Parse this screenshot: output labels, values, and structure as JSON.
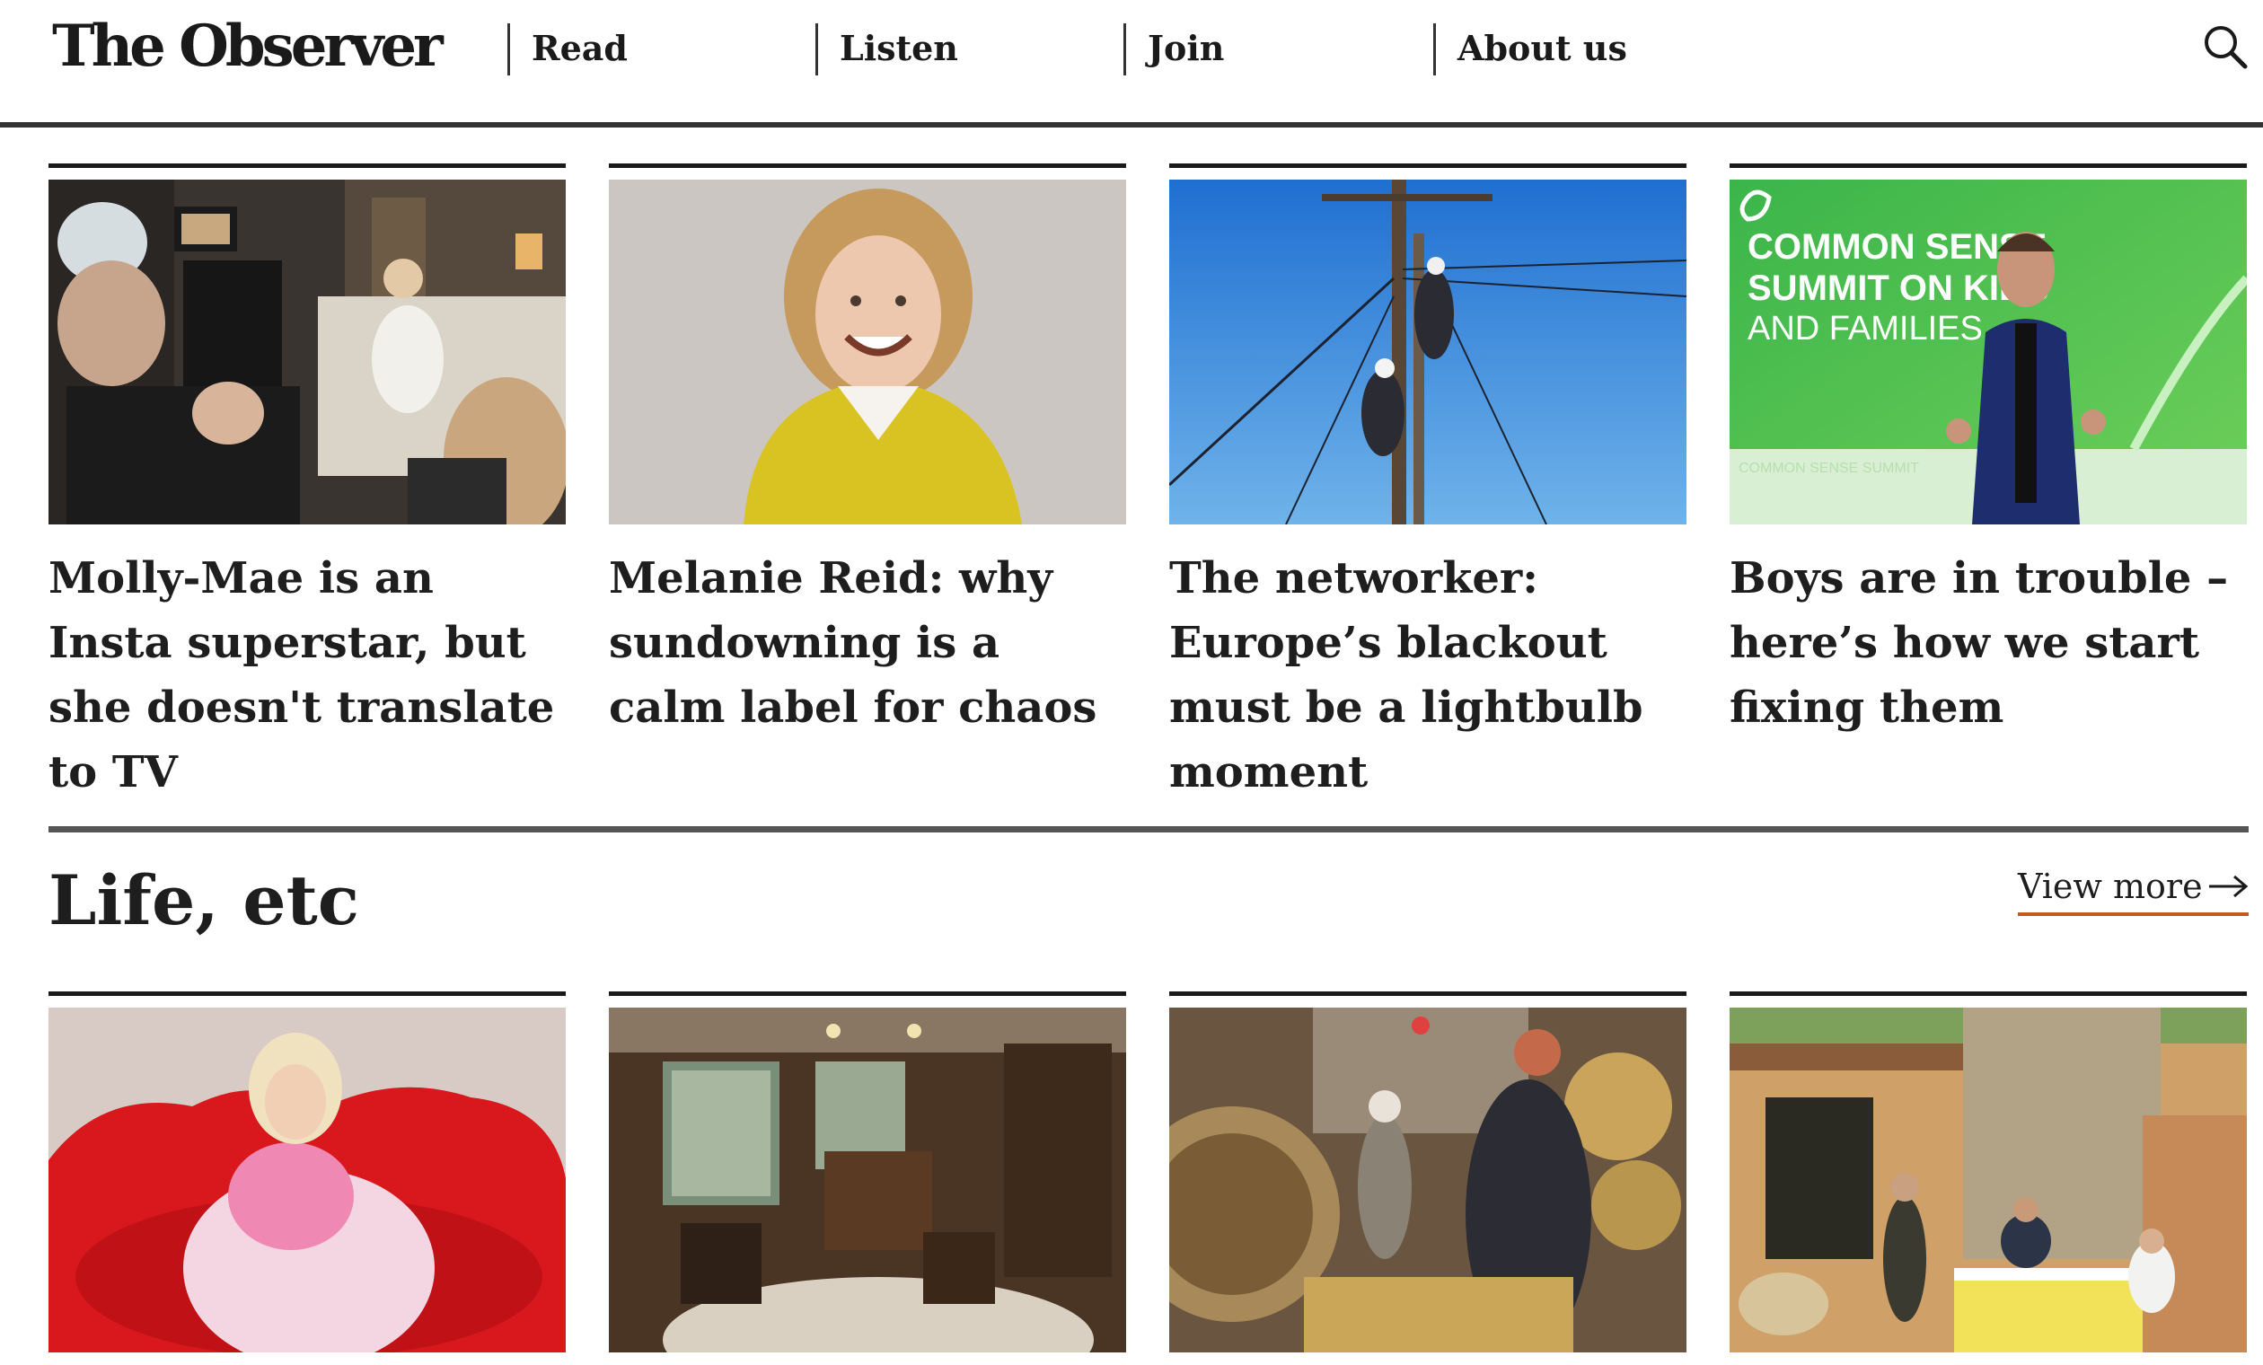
{
  "header": {
    "logo": "The Observer",
    "nav": [
      {
        "label": "Read"
      },
      {
        "label": "Listen"
      },
      {
        "label": "Join"
      },
      {
        "label": "About us"
      }
    ],
    "search_icon": "search-icon"
  },
  "top_cards": [
    {
      "headline": "Molly-Mae is an Insta superstar, but she doesn't translate to TV"
    },
    {
      "headline": "Melanie Reid: why sundowning is a calm label for chaos"
    },
    {
      "headline": "The networker: Europe’s blackout must be a lightbulb moment"
    },
    {
      "headline": "Boys are in trouble – here’s how we start fixing them"
    }
  ],
  "image_4": {
    "banner_line1": "COMMON SENSE",
    "banner_line2": "SUMMIT ON KIDS",
    "banner_line3": "AND FAMILIES",
    "strip_text": "COMMON SENSE SUMMIT"
  },
  "section": {
    "title": "Life, etc",
    "view_more": "View more",
    "arrow_icon": "arrow-right-icon"
  },
  "colors": {
    "accent_underline": "#c65a1a",
    "rule": "#1a1a1a"
  }
}
